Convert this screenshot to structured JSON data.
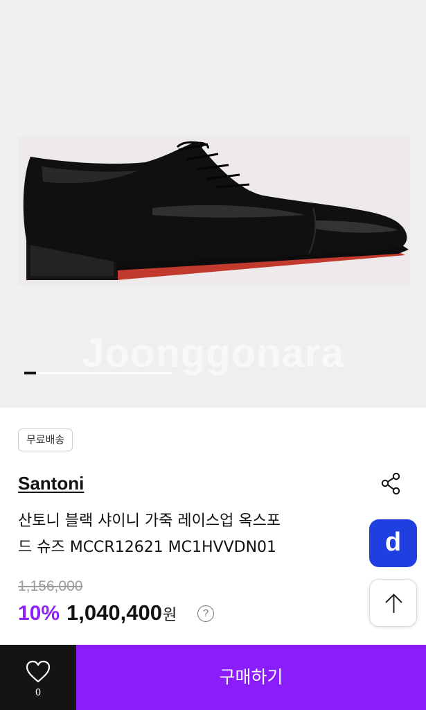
{
  "gallery": {
    "watermark": "Joonggonara",
    "current_page": 1,
    "progress_fraction": 0.08
  },
  "product": {
    "shipping_badge": "무료배송",
    "brand": "Santoni",
    "title_line1": "산토니 블랙 샤이니 가죽 레이스업 옥스포",
    "title_line2": "드 슈즈 MCCR12621 MC1HVVDN01",
    "original_price": "1,156,000",
    "discount": "10%",
    "price": "1,040,400",
    "currency": "원",
    "help_symbol": "?"
  },
  "side_buttons": {
    "d_logo": "d",
    "scroll_top_icon": "arrow-up-icon"
  },
  "bottom_bar": {
    "like_count": "0",
    "buy_label": "구매하기"
  },
  "colors": {
    "accent": "#8a1df9",
    "discount": "#8d22f5",
    "d_button": "#1f3fe0",
    "wish_bg": "#141414"
  }
}
